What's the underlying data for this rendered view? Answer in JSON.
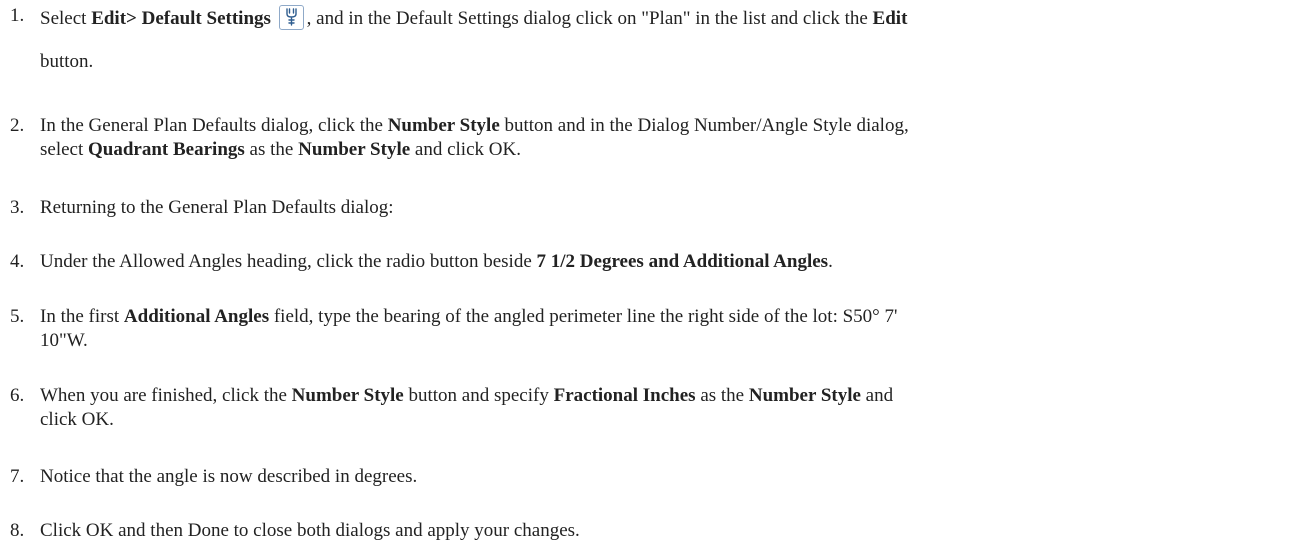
{
  "steps": [
    {
      "num": "1.",
      "parts": {
        "a": "Select ",
        "b": "Edit> Default Settings",
        "c": ", and in the Default Settings dialog click on \"Plan\" in the list and click the ",
        "d": "Edit",
        "e": "button."
      },
      "icon": "default-settings-icon"
    },
    {
      "num": "2.",
      "parts": {
        "a": "In the General Plan Defaults dialog, click the ",
        "b": "Number Style",
        "c": " button and in the Dialog Number/Angle Style dialog,",
        "d": "select ",
        "e": "Quadrant Bearings",
        "f": " as the ",
        "g": "Number Style",
        "h": " and click OK."
      }
    },
    {
      "num": "3.",
      "text": "Returning to the General Plan Defaults dialog:"
    },
    {
      "num": "4.",
      "parts": {
        "a": "Under the Allowed Angles heading, click the radio button beside ",
        "b": "7 1/2 Degrees and Additional Angles",
        "c": "."
      }
    },
    {
      "num": "5.",
      "parts": {
        "a": "In the first ",
        "b": "Additional Angles",
        "c": " field, type the bearing of the angled perimeter line the right side of the lot: S50° 7'",
        "d": "10\"W."
      }
    },
    {
      "num": "6.",
      "parts": {
        "a": "When you are finished, click the ",
        "b": "Number Style",
        "c": " button and specify ",
        "d": "Fractional Inches",
        "e": " as the ",
        "f": "Number Style",
        "g": " and",
        "h": "click OK."
      }
    },
    {
      "num": "7.",
      "text": "Notice that the angle is now described in degrees."
    },
    {
      "num": "8.",
      "text": "Click OK and then Done to close both dialogs and apply your changes."
    }
  ]
}
